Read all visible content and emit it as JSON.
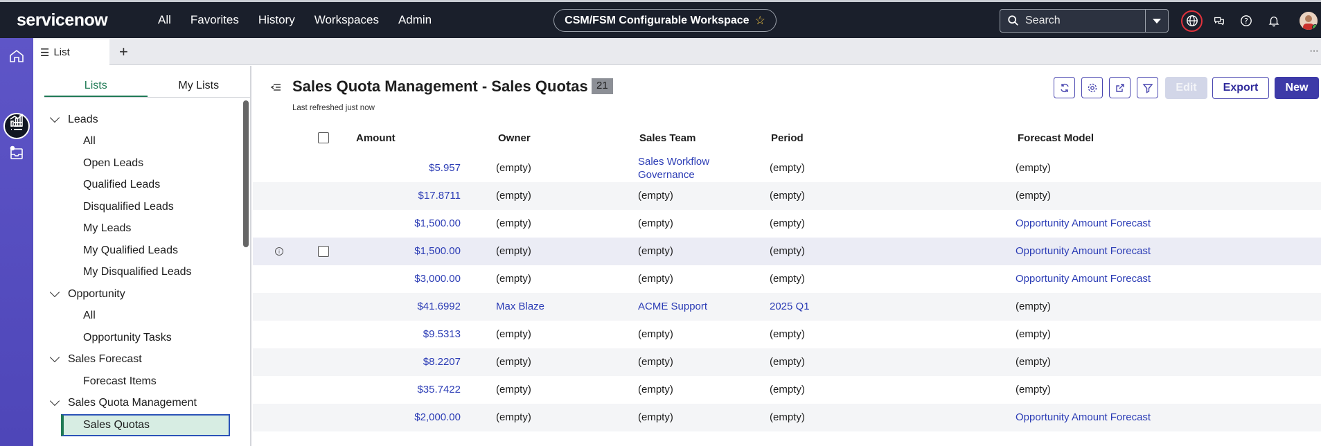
{
  "topnav": {
    "logo": "servicenow",
    "links": [
      "All",
      "Favorites",
      "History",
      "Workspaces",
      "Admin"
    ],
    "workspace": "CSM/FSM Configurable Workspace",
    "search_placeholder": "Search"
  },
  "tabbar": {
    "tab_label": "List",
    "add": "+",
    "more": "···"
  },
  "sidebar": {
    "tabs": [
      "Lists",
      "My Lists"
    ],
    "tree": [
      {
        "type": "group",
        "label": "Leads"
      },
      {
        "type": "item",
        "label": "All"
      },
      {
        "type": "item",
        "label": "Open Leads"
      },
      {
        "type": "item",
        "label": "Qualified Leads"
      },
      {
        "type": "item",
        "label": "Disqualified Leads"
      },
      {
        "type": "item",
        "label": "My Leads"
      },
      {
        "type": "item",
        "label": "My Qualified Leads"
      },
      {
        "type": "item",
        "label": "My Disqualified Leads"
      },
      {
        "type": "group",
        "label": "Opportunity"
      },
      {
        "type": "item",
        "label": "All"
      },
      {
        "type": "item",
        "label": "Opportunity Tasks"
      },
      {
        "type": "group",
        "label": "Sales Forecast"
      },
      {
        "type": "item",
        "label": "Forecast Items"
      },
      {
        "type": "group",
        "label": "Sales Quota Management"
      },
      {
        "type": "item",
        "label": "Sales Quotas",
        "selected": true
      }
    ]
  },
  "main": {
    "title": "Sales Quota Management - Sales Quotas",
    "count": "21",
    "refreshed": "Last refreshed just now",
    "buttons": {
      "edit": "Edit",
      "export": "Export",
      "new": "New"
    },
    "columns": [
      "Amount",
      "Owner",
      "Sales Team",
      "Period",
      "Forecast Model"
    ],
    "rows": [
      {
        "amount": "$5.957",
        "owner": "(empty)",
        "team": "Sales Workflow Governance",
        "team_link": true,
        "period": "(empty)",
        "model": "(empty)"
      },
      {
        "amount": "$17.8711",
        "owner": "(empty)",
        "team": "(empty)",
        "period": "(empty)",
        "model": "(empty)"
      },
      {
        "amount": "$1,500.00",
        "owner": "(empty)",
        "team": "(empty)",
        "period": "(empty)",
        "model": "Opportunity Amount Forecast",
        "model_link": true
      },
      {
        "amount": "$1,500.00",
        "owner": "(empty)",
        "team": "(empty)",
        "period": "(empty)",
        "model": "Opportunity Amount Forecast",
        "model_link": true,
        "hover": true
      },
      {
        "amount": "$3,000.00",
        "owner": "(empty)",
        "team": "(empty)",
        "period": "(empty)",
        "model": "Opportunity Amount Forecast",
        "model_link": true
      },
      {
        "amount": "$41.6992",
        "owner": "Max Blaze",
        "owner_link": true,
        "team": "ACME Support",
        "team_link": true,
        "period": "2025 Q1",
        "period_link": true,
        "model": "(empty)"
      },
      {
        "amount": "$9.5313",
        "owner": "(empty)",
        "team": "(empty)",
        "period": "(empty)",
        "model": "(empty)"
      },
      {
        "amount": "$8.2207",
        "owner": "(empty)",
        "team": "(empty)",
        "period": "(empty)",
        "model": "(empty)"
      },
      {
        "amount": "$35.7422",
        "owner": "(empty)",
        "team": "(empty)",
        "period": "(empty)",
        "model": "(empty)"
      },
      {
        "amount": "$2,000.00",
        "owner": "(empty)",
        "team": "(empty)",
        "period": "(empty)",
        "model": "Opportunity Amount Forecast",
        "model_link": true
      }
    ]
  },
  "colors": {
    "nav_bg": "#1a1f2b",
    "rail": "#5e55c7",
    "accent": "#3d3aa8",
    "link": "#2b3cb5",
    "list_tab": "#1f7a55"
  }
}
